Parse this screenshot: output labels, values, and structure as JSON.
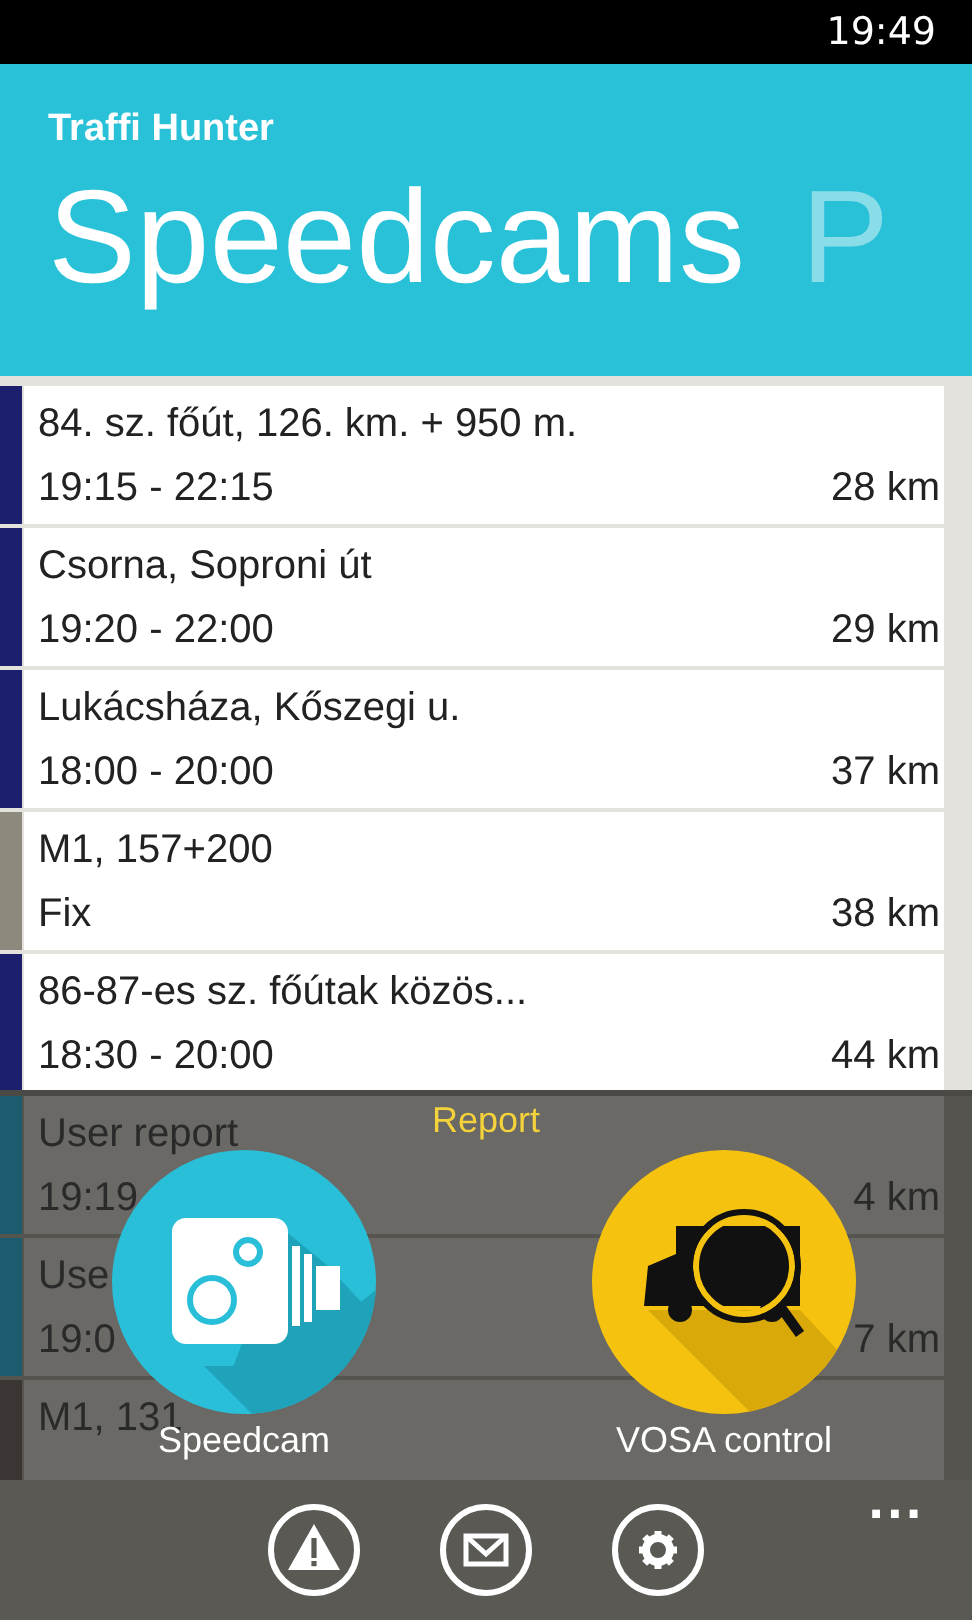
{
  "status_bar": {
    "time": "19:49"
  },
  "app_title": "Traffi Hunter",
  "pivot": [
    {
      "label": "Speedcams",
      "selected": true
    },
    {
      "label": "P",
      "selected": false
    }
  ],
  "rows": [
    {
      "title": "84. sz. főút, 126. km. + 950 m.",
      "detail": "19:15 - 22:15",
      "distance": "28 km",
      "color": "#1b1f6e",
      "dimmed": false
    },
    {
      "title": "Csorna, Soproni út",
      "detail": "19:20 - 22:00",
      "distance": "29 km",
      "color": "#1b1f6e",
      "dimmed": false
    },
    {
      "title": "Lukácsháza, Kőszegi u.",
      "detail": "18:00 - 20:00",
      "distance": "37 km",
      "color": "#1b1f6e",
      "dimmed": false
    },
    {
      "title": "M1, 157+200",
      "detail": "Fix",
      "distance": "38 km",
      "color": "#8e897d",
      "dimmed": false
    },
    {
      "title": "86-87-es sz. főútak közös...",
      "detail": "18:30 - 20:00",
      "distance": "44 km",
      "color": "#1b1f6e",
      "dimmed": false
    },
    {
      "title": "User report",
      "detail": "19:19",
      "distance": "4 km",
      "color": "#1d5c6e",
      "dimmed": true
    },
    {
      "title": "Use",
      "detail": "19:0",
      "distance": "7 km",
      "color": "#1d5c6e",
      "dimmed": true
    },
    {
      "title": "M1, 131",
      "color": "#3b3634",
      "dimmed": true
    }
  ],
  "report": {
    "title": "Report",
    "actions": [
      {
        "kind": "speedcam",
        "label": "Speedcam"
      },
      {
        "kind": "vosa",
        "label": "VOSA control"
      }
    ]
  },
  "app_bar": {
    "buttons": [
      {
        "kind": "warning"
      },
      {
        "kind": "mail"
      },
      {
        "kind": "settings"
      }
    ],
    "more": "..."
  }
}
